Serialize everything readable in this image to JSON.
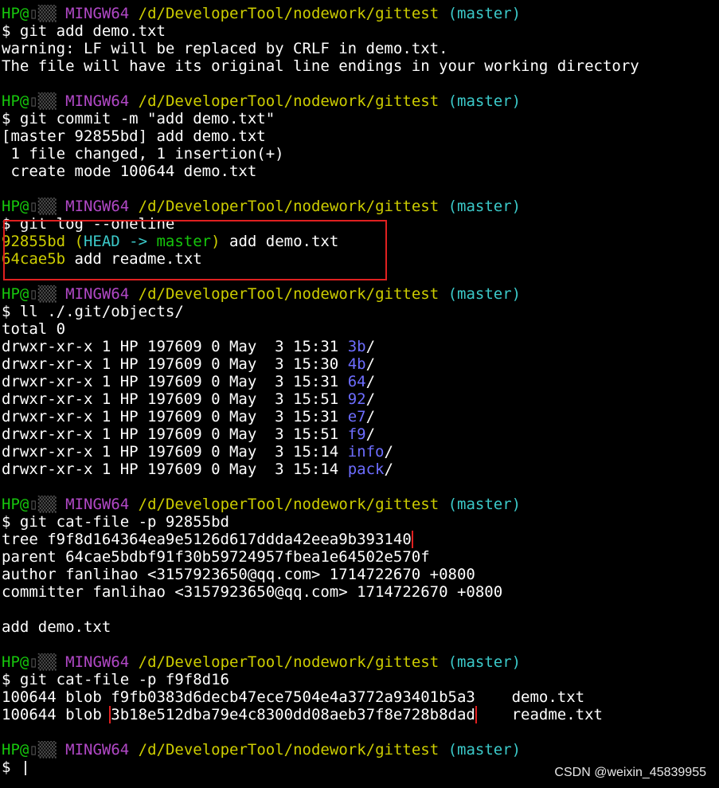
{
  "prompt": {
    "user": "HP@",
    "mark": "▯",
    "host": "▒▒",
    "env": "MINGW64",
    "path": "/d/DeveloperTool/nodework/gittest",
    "branch": "(master)"
  },
  "blocks": [
    {
      "cmd": "$ git add demo.txt",
      "output": [
        "warning: LF will be replaced by CRLF in demo.txt.",
        "The file will have its original line endings in your working directory"
      ]
    },
    {
      "cmd": "$ git commit -m \"add demo.txt\"",
      "output": [
        "[master 92855bd] add demo.txt",
        " 1 file changed, 1 insertion(+)",
        " create mode 100644 demo.txt"
      ]
    },
    {
      "cmd": "$ git log --oneline",
      "log": [
        {
          "hash": "92855bd",
          "ref_open": " (",
          "head": "HEAD ->",
          "branch": " master",
          "ref_close": ")",
          "msg": " add demo.txt"
        },
        {
          "hash": "64cae5b",
          "msg": " add readme.txt"
        }
      ]
    },
    {
      "cmd": "$ ll ./.git/objects/",
      "total": "total 0",
      "listing": [
        {
          "meta": "drwxr-xr-x 1 HP 197609 0 May  3 15:31 ",
          "name": "3b",
          "slash": "/"
        },
        {
          "meta": "drwxr-xr-x 1 HP 197609 0 May  3 15:30 ",
          "name": "4b",
          "slash": "/"
        },
        {
          "meta": "drwxr-xr-x 1 HP 197609 0 May  3 15:31 ",
          "name": "64",
          "slash": "/"
        },
        {
          "meta": "drwxr-xr-x 1 HP 197609 0 May  3 15:51 ",
          "name": "92",
          "slash": "/"
        },
        {
          "meta": "drwxr-xr-x 1 HP 197609 0 May  3 15:31 ",
          "name": "e7",
          "slash": "/"
        },
        {
          "meta": "drwxr-xr-x 1 HP 197609 0 May  3 15:51 ",
          "name": "f9",
          "slash": "/"
        },
        {
          "meta": "drwxr-xr-x 1 HP 197609 0 May  3 15:14 ",
          "name": "info",
          "slash": "/"
        },
        {
          "meta": "drwxr-xr-x 1 HP 197609 0 May  3 15:14 ",
          "name": "pack",
          "slash": "/"
        }
      ]
    },
    {
      "cmd": "$ git cat-file -p 92855bd",
      "output": [
        "tree f9f8d164364ea9e5126d617ddda42eea9b393140",
        "parent 64cae5bdbf91f30b59724957fbea1e64502e570f",
        "author fanlihao <3157923650@qq.com> 1714722670 +0800",
        "committer fanlihao <3157923650@qq.com> 1714722670 +0800",
        "",
        "add demo.txt"
      ]
    },
    {
      "cmd": "$ git cat-file -p f9f8d16",
      "tree_entries": [
        {
          "pre": "100644 blob ",
          "hash": "f9fb0383d6decb47ece7504e4a3772a93401b5a3",
          "name": "    demo.txt"
        },
        {
          "pre": "100644 blob ",
          "hash": "3b18e512dba79e4c8300dd08aeb37f8e728b8dad",
          "name": "    readme.txt"
        }
      ]
    },
    {
      "cmd": "$ "
    }
  ],
  "watermark": "CSDN @weixin_45839955",
  "colors": {
    "green": "#16c60c",
    "magenta": "#b148c6",
    "yellow": "#cdcd00",
    "cyan": "#3bc9c9",
    "blue": "#6d6dff",
    "highlight": "#e02020"
  }
}
